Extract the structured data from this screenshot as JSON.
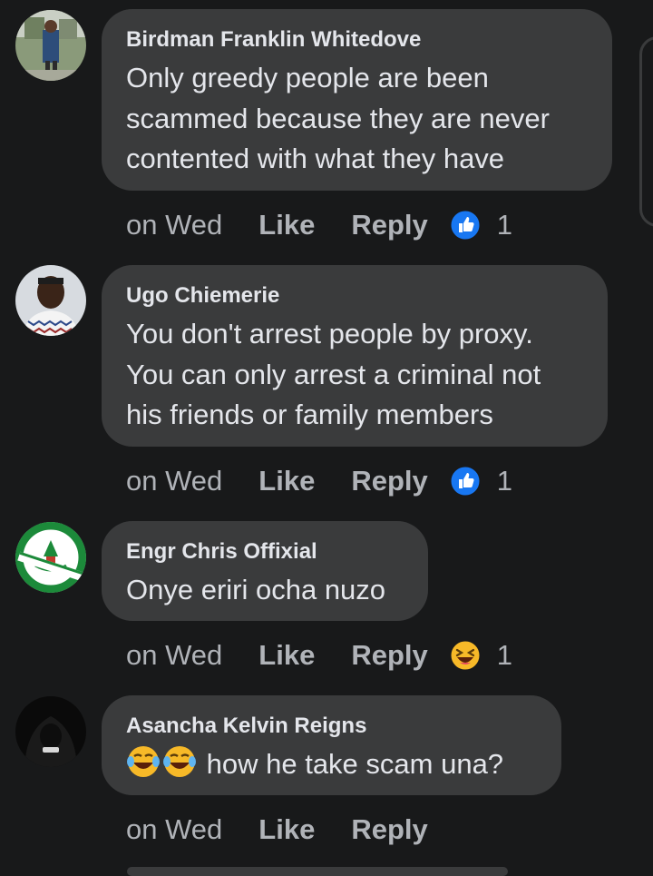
{
  "comments": [
    {
      "author": "Birdman Franklin Whitedove",
      "text": "Only greedy people are been scammed because they are never contented with what they have",
      "time": "on Wed",
      "like": "Like",
      "reply": "Reply",
      "reaction": "like-reaction-icon",
      "count": "1"
    },
    {
      "author": "Ugo Chiemerie",
      "text": "You don't arrest people by proxy. You can only arrest a criminal not his friends or family members",
      "time": "on Wed",
      "like": "Like",
      "reply": "Reply",
      "reaction": "like-reaction-icon",
      "count": "1"
    },
    {
      "author": "Engr Chris Offixial",
      "text": "Onye eriri ocha nuzo",
      "time": "on Wed",
      "like": "Like",
      "reply": "Reply",
      "reaction": "haha-reaction-icon",
      "count": "1"
    },
    {
      "author": "Asancha Kelvin Reigns",
      "text": "how he take scam una?",
      "time": "on Wed",
      "like": "Like",
      "reply": "Reply"
    }
  ],
  "colors": {
    "background": "#18191a",
    "bubble": "#3a3b3c",
    "text": "#e4e6eb",
    "muted": "#b0b3b8",
    "like_blue": "#1877f2",
    "haha_yellow": "#f7b928"
  }
}
